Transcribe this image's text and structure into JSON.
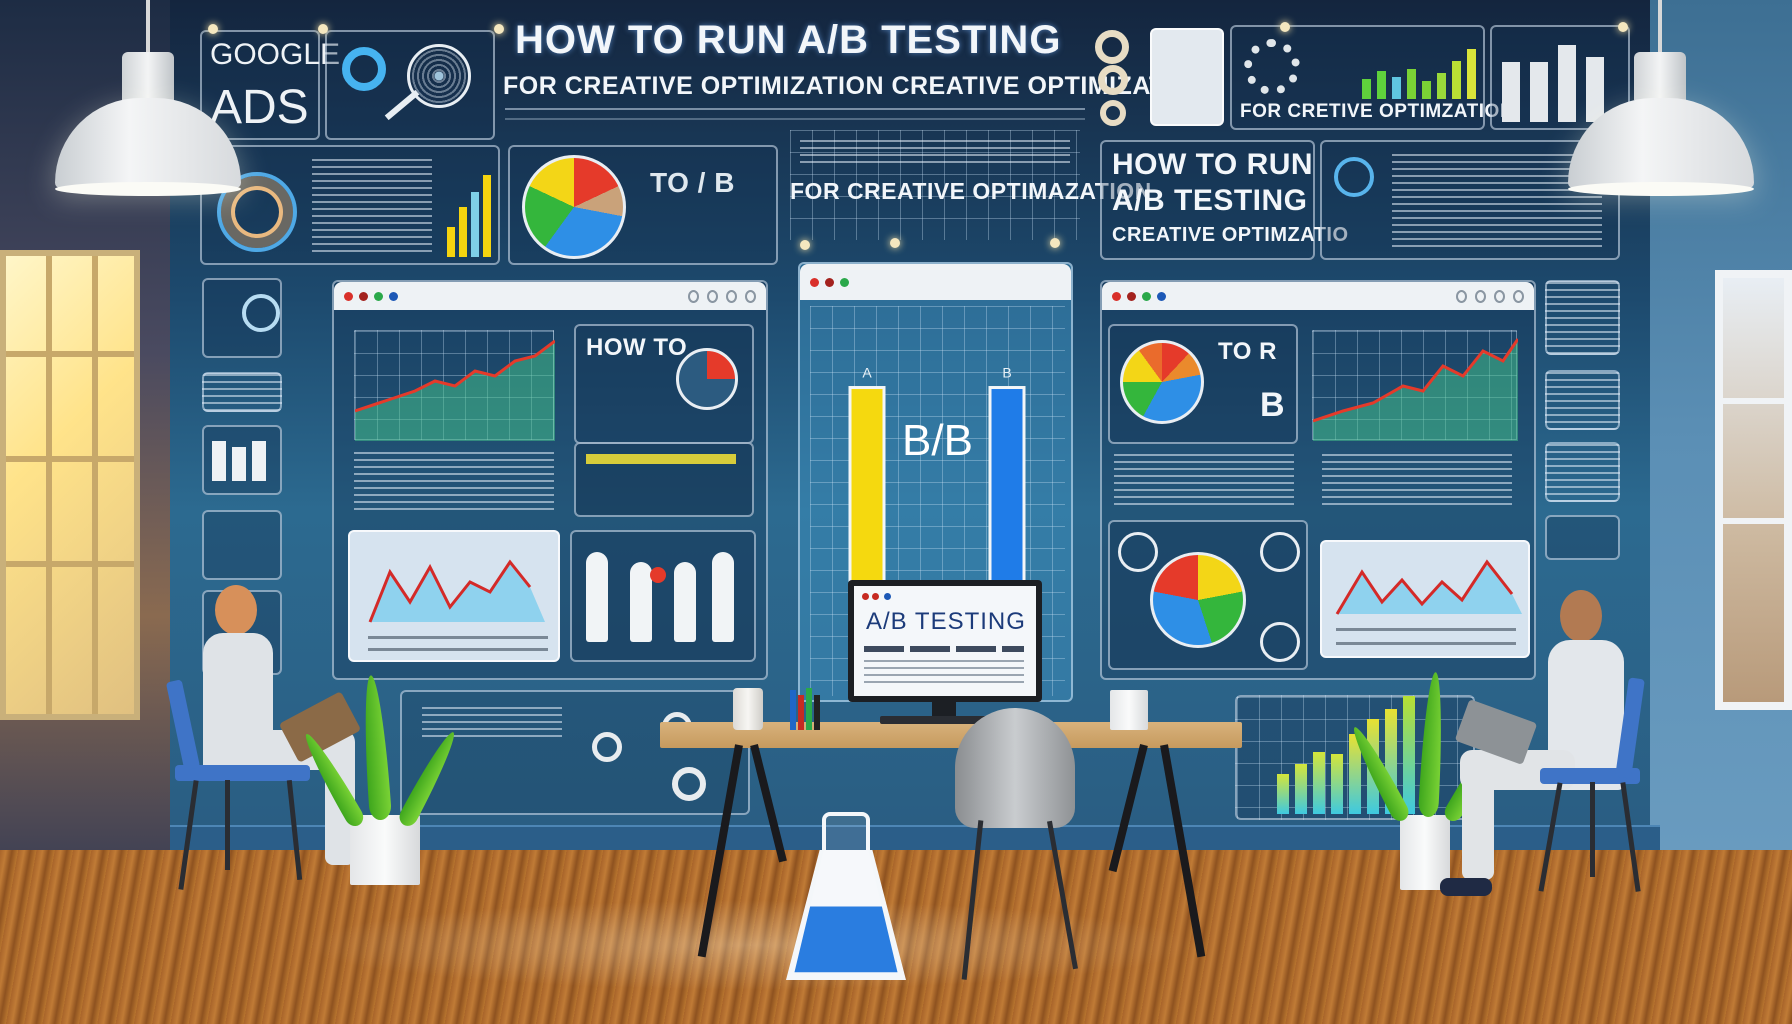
{
  "scene": {
    "description": "Illustrated office with a large digital dashboard wall about A/B testing for Google Ads creative optimization; two people seated on blue chairs with laptops, a wooden desk with a monitor, potted plants, a lab flask and pendant lamps",
    "colors": {
      "wall_dark": "#14253e",
      "wall_mid": "#2c6a90",
      "floor_wood": "#b8752f",
      "bar_a_yellow": "#f5d90f",
      "bar_b_blue": "#1f7ce8",
      "chair_blue": "#3f74c7",
      "accent_red": "#e0342a",
      "accent_green": "#36b53a"
    }
  },
  "wall": {
    "logo_panel": {
      "line1": "GOOGLE",
      "line2": "ADS"
    },
    "headline": {
      "title": "HOW TO RUN A/B TESTING",
      "subtitle": "FOR CREATIVE OPTIMIZATION CREATIVE OPTIMIZATION"
    },
    "top_right_caption": "FOR CRETIVE OPTIMZATION",
    "center_caption": "FOR CREATIVE OPTIMAZATION",
    "right_title_panel": {
      "line1": "HOW TO RUN",
      "line2": "A/B TESTING",
      "line3": "CREATIVE OPTIMZATIO"
    },
    "pie_panel_label": "TO / B",
    "left_browser_panel": {
      "heading": "HOW TO"
    },
    "right_browser_panel": {
      "heading": "TO R",
      "badge": "B"
    },
    "center_chart": {
      "bar_a_label": "A",
      "bar_b_label": "B",
      "overlay_text": "B/B"
    }
  },
  "chart_data": {
    "type": "bar",
    "title": "B/B",
    "categories": [
      "A",
      "B"
    ],
    "values": [
      88,
      88
    ],
    "xlabel": "",
    "ylabel": "",
    "ylim": [
      0,
      100
    ],
    "grid": true,
    "colors": [
      "#f5d90f",
      "#1f7ce8"
    ]
  },
  "desk": {
    "monitor": {
      "title": "A/B TESTING"
    }
  }
}
